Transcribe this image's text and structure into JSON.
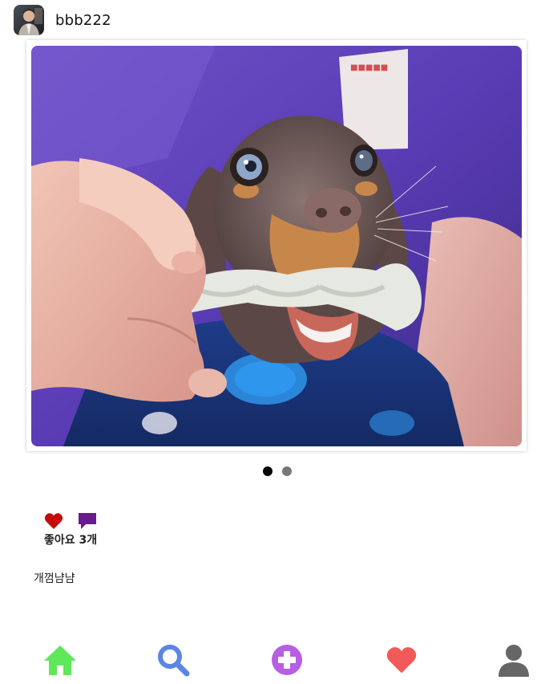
{
  "post": {
    "username": "bbb222",
    "likes_text": "좋아요 3개",
    "caption": "개껌냠냠",
    "carousel": {
      "total": 2,
      "active_index": 0
    }
  },
  "icons": {
    "like": "heart-icon",
    "comment": "speech-bubble-icon"
  },
  "nav": {
    "items": [
      {
        "name": "home",
        "icon": "home-icon",
        "color": "#5ee85a"
      },
      {
        "name": "search",
        "icon": "search-icon",
        "color": "#5b86e5"
      },
      {
        "name": "add",
        "icon": "plus-circle-icon",
        "color": "#b65fe3"
      },
      {
        "name": "activity",
        "icon": "heart-icon",
        "color": "#f25a5a"
      },
      {
        "name": "profile",
        "icon": "user-icon",
        "color": "#666666"
      }
    ]
  },
  "colors": {
    "like_heart": "#c40c0c",
    "comment_bubble": "#6a1a8c"
  }
}
